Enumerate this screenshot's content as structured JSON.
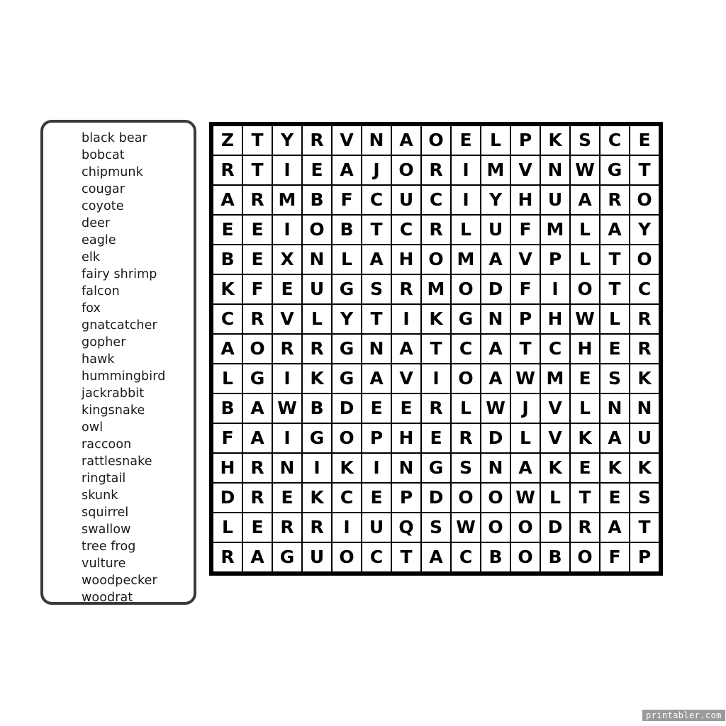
{
  "puzzle": {
    "word_list": [
      "black bear",
      "bobcat",
      "chipmunk",
      "cougar",
      "coyote",
      "deer",
      "eagle",
      "elk",
      "fairy shrimp",
      "falcon",
      "fox",
      "gnatcatcher",
      "gopher",
      "hawk",
      "hummingbird",
      "jackrabbit",
      "kingsnake",
      "owl",
      "raccoon",
      "rattlesnake",
      "ringtail",
      "skunk",
      "squirrel",
      "swallow",
      "tree frog",
      "vulture",
      "woodpecker",
      "woodrat"
    ],
    "grid": {
      "rows": 15,
      "cols": 15,
      "letters": [
        [
          "Z",
          "T",
          "Y",
          "R",
          "V",
          "N",
          "A",
          "O",
          "E",
          "L",
          "P",
          "K",
          "S",
          "C",
          "E"
        ],
        [
          "R",
          "T",
          "I",
          "E",
          "A",
          "J",
          "O",
          "R",
          "I",
          "M",
          "V",
          "N",
          "W",
          "G",
          "T"
        ],
        [
          "A",
          "R",
          "M",
          "B",
          "F",
          "C",
          "U",
          "C",
          "I",
          "Y",
          "H",
          "U",
          "A",
          "R",
          "O"
        ],
        [
          "E",
          "E",
          "I",
          "O",
          "B",
          "T",
          "C",
          "R",
          "L",
          "U",
          "F",
          "M",
          "L",
          "A",
          "Y"
        ],
        [
          "B",
          "E",
          "X",
          "N",
          "L",
          "A",
          "H",
          "O",
          "M",
          "A",
          "V",
          "P",
          "L",
          "T",
          "O"
        ],
        [
          "K",
          "F",
          "E",
          "U",
          "G",
          "S",
          "R",
          "M",
          "O",
          "D",
          "F",
          "I",
          "O",
          "T",
          "C"
        ],
        [
          "C",
          "R",
          "V",
          "L",
          "Y",
          "T",
          "I",
          "K",
          "G",
          "N",
          "P",
          "H",
          "W",
          "L",
          "R"
        ],
        [
          "A",
          "O",
          "R",
          "R",
          "G",
          "N",
          "A",
          "T",
          "C",
          "A",
          "T",
          "C",
          "H",
          "E",
          "R"
        ],
        [
          "L",
          "G",
          "I",
          "K",
          "G",
          "A",
          "V",
          "I",
          "O",
          "A",
          "W",
          "M",
          "E",
          "S",
          "K"
        ],
        [
          "B",
          "A",
          "W",
          "B",
          "D",
          "E",
          "E",
          "R",
          "L",
          "W",
          "J",
          "V",
          "L",
          "N",
          "N"
        ],
        [
          "F",
          "A",
          "I",
          "G",
          "O",
          "P",
          "H",
          "E",
          "R",
          "D",
          "L",
          "V",
          "K",
          "A",
          "U"
        ],
        [
          "H",
          "R",
          "N",
          "I",
          "K",
          "I",
          "N",
          "G",
          "S",
          "N",
          "A",
          "K",
          "E",
          "K",
          "K"
        ],
        [
          "D",
          "R",
          "E",
          "K",
          "C",
          "E",
          "P",
          "D",
          "O",
          "O",
          "W",
          "L",
          "T",
          "E",
          "S"
        ],
        [
          "L",
          "E",
          "R",
          "R",
          "I",
          "U",
          "Q",
          "S",
          "W",
          "O",
          "O",
          "D",
          "R",
          "A",
          "T"
        ],
        [
          "R",
          "A",
          "G",
          "U",
          "O",
          "C",
          "T",
          "A",
          "C",
          "B",
          "O",
          "B",
          "O",
          "F",
          "P"
        ]
      ]
    }
  },
  "watermark": {
    "text": "printabler.com"
  }
}
